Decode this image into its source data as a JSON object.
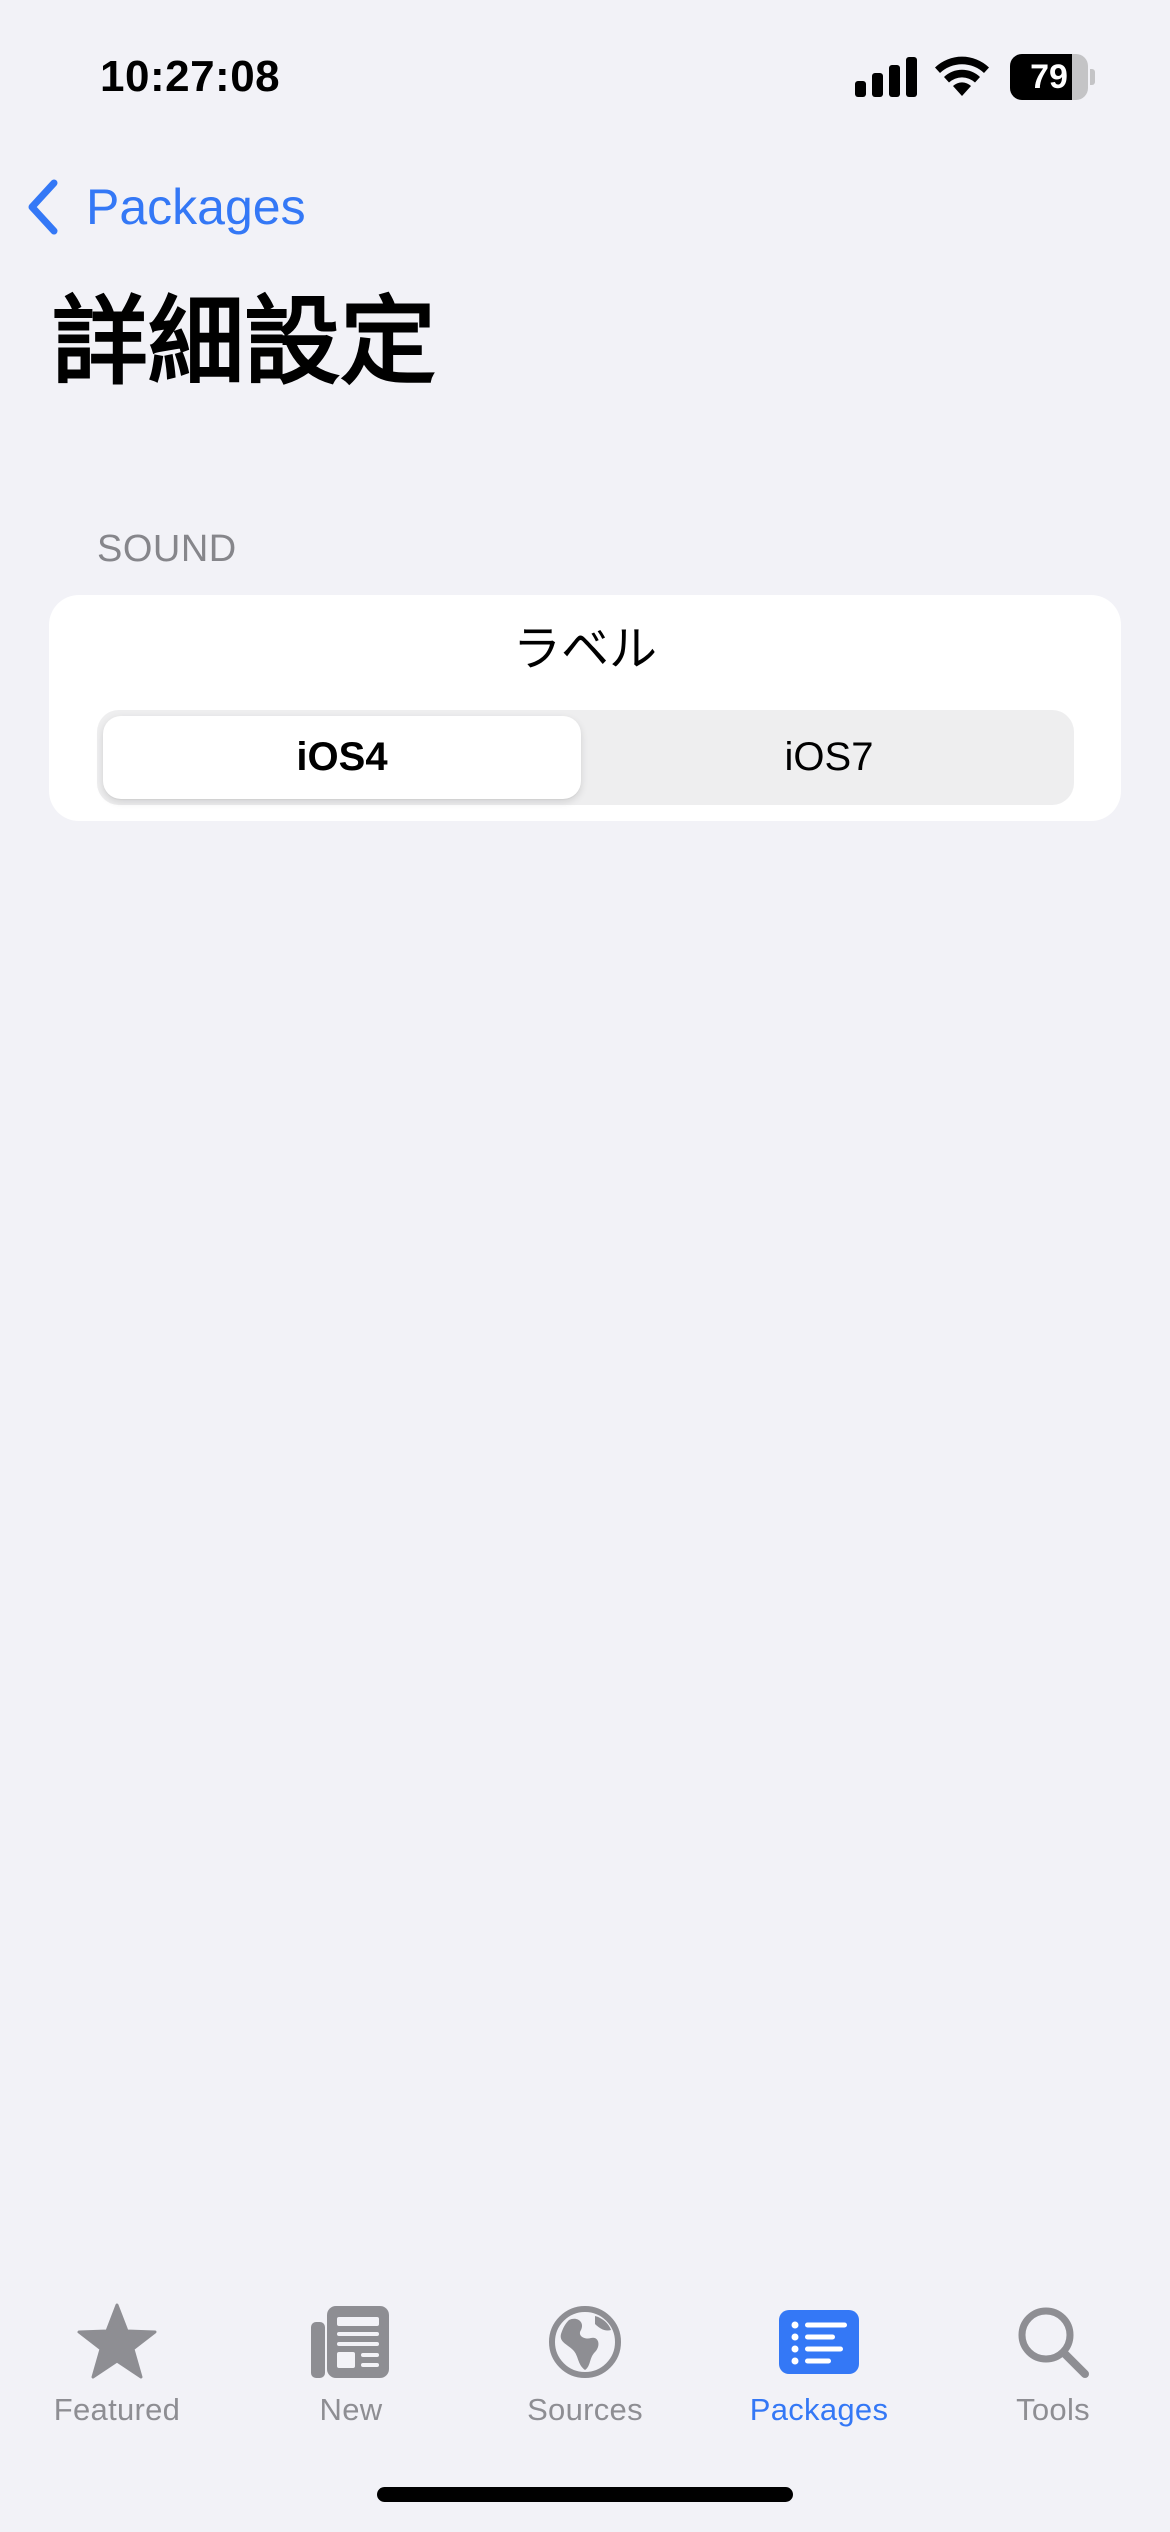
{
  "status_bar": {
    "time": "10:27:08",
    "battery_percent": "79",
    "battery_level": 0.79
  },
  "nav": {
    "back_label": "Packages",
    "title": "詳細設定"
  },
  "section": {
    "header": "SOUND",
    "row_label": "ラベル",
    "segments": [
      {
        "label": "iOS4",
        "selected": true
      },
      {
        "label": "iOS7",
        "selected": false
      }
    ]
  },
  "tab_bar": {
    "tabs": [
      {
        "label": "Featured",
        "icon": "star-icon",
        "active": false
      },
      {
        "label": "New",
        "icon": "newspaper-icon",
        "active": false
      },
      {
        "label": "Sources",
        "icon": "globe-icon",
        "active": false
      },
      {
        "label": "Packages",
        "icon": "list-icon",
        "active": true
      },
      {
        "label": "Tools",
        "icon": "magnifier-icon",
        "active": false
      }
    ]
  },
  "colors": {
    "accent": "#3478f6",
    "background": "#f2f2f7",
    "inactive": "#8e8e93"
  }
}
